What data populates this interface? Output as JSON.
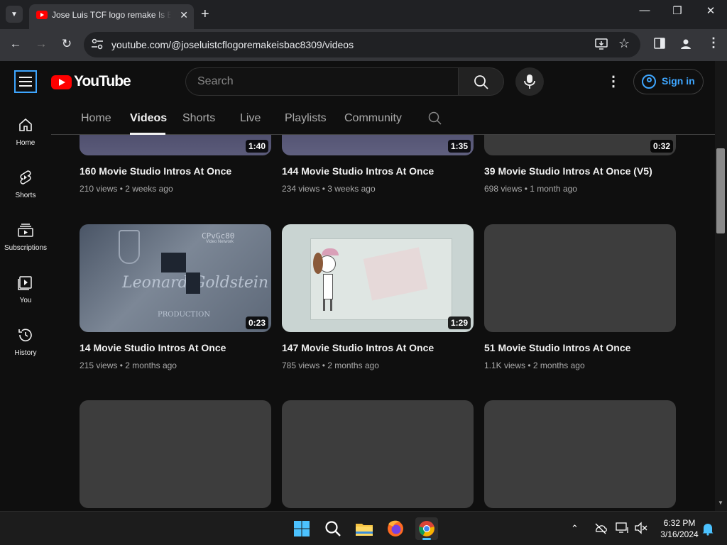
{
  "browser": {
    "tab_title": "Jose Luis TCF logo remake Is Back",
    "url": "youtube.com/@joseluistcflogoremakeisbac8309/videos"
  },
  "header": {
    "logo_text": "YouTube",
    "search_placeholder": "Search",
    "signin_label": "Sign in"
  },
  "guide": [
    {
      "label": "Home",
      "icon": "home-icon"
    },
    {
      "label": "Shorts",
      "icon": "shorts-icon"
    },
    {
      "label": "Subscriptions",
      "icon": "subscriptions-icon"
    },
    {
      "label": "You",
      "icon": "you-icon"
    },
    {
      "label": "History",
      "icon": "history-icon"
    }
  ],
  "channel_tabs": [
    "Home",
    "Videos",
    "Shorts",
    "Live",
    "Playlists",
    "Community"
  ],
  "active_tab": "Videos",
  "videos": [
    {
      "title": "160 Movie Studio Intros At Once",
      "views": "210 views",
      "age": "2 weeks ago",
      "duration": "1:40"
    },
    {
      "title": "144 Movie Studio Intros At Once",
      "views": "234 views",
      "age": "3 weeks ago",
      "duration": "1:35"
    },
    {
      "title": "39 Movie Studio Intros At Once (V5)",
      "views": "698 views",
      "age": "1 month ago",
      "duration": "0:32"
    },
    {
      "title": "14 Movie Studio Intros At Once",
      "views": "215 views",
      "age": "2 months ago",
      "duration": "0:23"
    },
    {
      "title": "147 Movie Studio Intros At Once",
      "views": "785 views",
      "age": "2 months ago",
      "duration": "1:29"
    },
    {
      "title": "51 Movie Studio Intros At Once",
      "views": "1.1K views",
      "age": "2 months ago",
      "duration": ""
    }
  ],
  "thumb_text": {
    "v4_overlay_1": "CPvGc80",
    "v4_overlay_2": "Video Network",
    "v4_overlay_3": "Leonard Goldstein",
    "v4_overlay_4": "PRODUCTION"
  },
  "taskbar": {
    "time": "6:32 PM",
    "date": "3/16/2024"
  },
  "colors": {
    "accent": "#3ea6ff",
    "youtube_red": "#ff0000",
    "background": "#0f0f0f"
  }
}
